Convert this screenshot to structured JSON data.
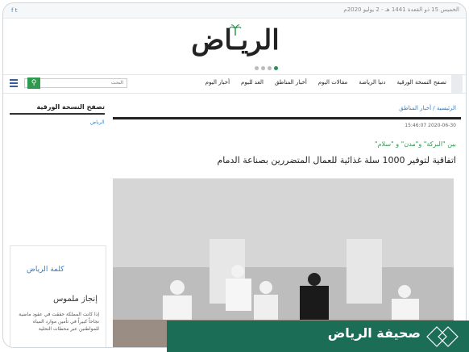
{
  "topbar": {
    "date_text": "الخميس 15 ذو القعدة 1441 هـ - 2 يوليو 2020م",
    "social": "f  t"
  },
  "masthead": {
    "logo": "الريـاض"
  },
  "nav": {
    "items": [
      "أخبار اليوم",
      "الغد لليوم",
      "أخبار المناطق",
      "مقالات اليوم",
      "دنيا الرياضة",
      "تصفح النسخة الورقية"
    ]
  },
  "search": {
    "placeholder": "البحث"
  },
  "sidebar": {
    "title": "تصفح النسخة الورقية",
    "thumb_label": "الرياض",
    "brand": "كلمة الرياض",
    "heading": "إنجاز ملموس",
    "paragraph": "إذا كانت المملكة حققت في عقود ماضية نجاحاً كبيراً في تأمين موارد المياه للمواطنين عبر محطات التحلية"
  },
  "article": {
    "breadcrumb": "الرئيسية / أخبار المناطق",
    "timestamp": "15:46:07 2020-06-30",
    "kicker": "بين \"البركة\" و\"مدن\" و \"سلام\"",
    "headline": "اتفاقية لتوفير 1000 سلة غذائية للعمال المتضررين بصناعة الدمام"
  },
  "banner": {
    "label": "صحيفة الرياض"
  },
  "colors": {
    "accent": "#2e9a4e",
    "link": "#2d7fd0",
    "banner": "#1b6d56"
  }
}
